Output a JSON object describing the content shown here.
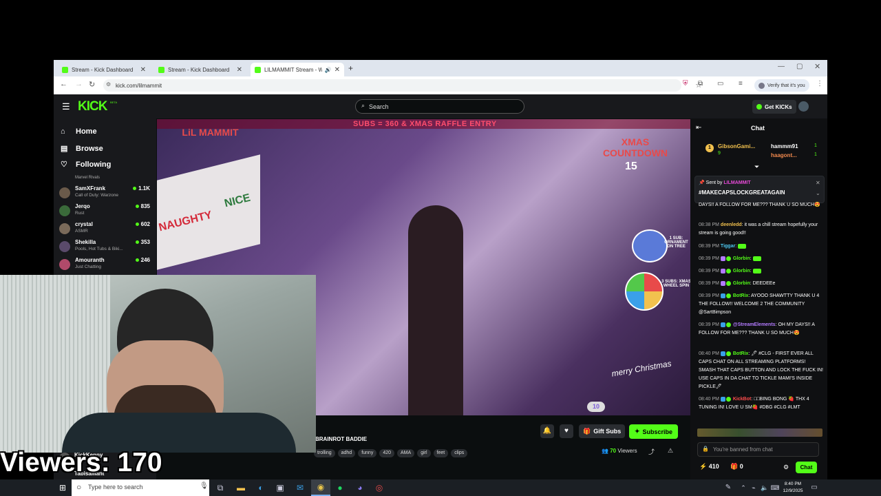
{
  "browser": {
    "tabs": [
      {
        "title": "Stream - Kick Dashboard",
        "active": false
      },
      {
        "title": "Stream - Kick Dashboard",
        "active": false
      },
      {
        "title": "LILMAMMIT Stream - Watch",
        "active": true
      }
    ],
    "url": "kick.com/lilmammit",
    "verify_label": "Verify that it's you"
  },
  "kick": {
    "logo": "KICK",
    "logo_beta": "BETA",
    "search_placeholder": "Search",
    "get_kicks": "Get KICKs",
    "nav": {
      "home": "Home",
      "browse": "Browse",
      "following": "Following"
    },
    "following_partial": "Marvel Rivals",
    "channels": [
      {
        "name": "SamXFrank",
        "game": "Call of Duty: Warzone",
        "viewers": "1.1K"
      },
      {
        "name": "Jerqo",
        "game": "Rust",
        "viewers": "835"
      },
      {
        "name": "crystal",
        "game": "ASMR",
        "viewers": "602"
      },
      {
        "name": "Shekilla",
        "game": "Pools, Hot Tubs & Biki...",
        "viewers": "353"
      },
      {
        "name": "Amouranth",
        "game": "Just Chatting",
        "viewers": "246"
      }
    ],
    "bottom_channels": [
      {
        "name": "KickKenny",
        "game": ""
      },
      {
        "name": "Tabisaillant",
        "game": ""
      }
    ],
    "stream": {
      "overlay_top": "SUBS = 360 & XMAS RAFFLE ENTRY",
      "overlay_lil": "LiL MAMMIT",
      "overlay_countdown": "XMAS COUNTDOWN",
      "overlay_countdown_num": "15",
      "overlay_naughty": "NAUGHTY",
      "overlay_nice": "NICE",
      "overlay_sub1": "1 SUB: ORNAMENT ON TREE",
      "overlay_sub3": "3 SUBS: XMAS WHEEL SPIN",
      "overlay_merry": "merry Christmas",
      "overlay_sub_count": "10",
      "title": "BRAINROT BADDIE",
      "tags": [
        "trolling",
        "adhd",
        "funny",
        "420",
        "AMA",
        "girl",
        "feet",
        "clips"
      ],
      "gift_subs": "Gift Subs",
      "subscribe": "Subscribe",
      "viewers": "70",
      "viewers_label": "Viewers"
    },
    "chat": {
      "title": "Chat",
      "top_gifters": [
        {
          "rank": "1",
          "name": "GibsonGami...",
          "count": "9"
        },
        {
          "rank": "",
          "name": "hammm91",
          "count": "1"
        },
        {
          "rank": "",
          "name": "haagont...",
          "count": "1"
        }
      ],
      "pinned_by_label": "Sent by",
      "pinned_by": "LILMAMMIT",
      "pinned_text": "#MAKECAPSLOCKGREATAGAIN",
      "messages": [
        {
          "time": "",
          "user": "",
          "text": "DAYS!! A FOLLOW FOR ME??? THANK U SO MUCH😍"
        },
        {
          "time": "08:38 PM",
          "user": "deenledd",
          "color": "#f2c14e",
          "text": "it was a chill stream hopefully your stream is going good!!"
        },
        {
          "time": "08:39 PM",
          "user": "Tiggar",
          "color": "#4ec9f2",
          "text": ""
        },
        {
          "time": "08:39 PM",
          "user": "Glorbin",
          "color": "#53fc18",
          "text": ""
        },
        {
          "time": "08:39 PM",
          "user": "Glorbin",
          "color": "#53fc18",
          "text": ""
        },
        {
          "time": "08:39 PM",
          "user": "Glorbin",
          "color": "#53fc18",
          "text": "DEEDEEe"
        },
        {
          "time": "08:39 PM",
          "user": "BotRix",
          "color": "#53fc18",
          "text": "AYOOO SHAWTTY THANK U 4 THE FOLLOW!! WELCOME 2 THE COMMUNITY @SartBimpson"
        },
        {
          "time": "08:39 PM",
          "user": "@StreamElements",
          "color": "#b37bff",
          "text": "OH MY DAYS!! A FOLLOW FOR ME??? THANK U SO MUCH😍"
        },
        {
          "time": "08:40 PM",
          "user": "BotRix",
          "color": "#53fc18",
          "text": "🖊 #CLG - FIRST EVER ALL CAPS CHAT ON ALL STREAMING PLATFORMS! SMASH THAT CAPS BUTTON AND LOCK THE FUCK IN! USE CAPS IN DA CHAT TO TICKLE MAMI'S INSIDE PICKLE🖊"
        },
        {
          "time": "08:40 PM",
          "user": "KickBot",
          "color": "#ff4d4d",
          "text": "□□BING BONG 🍓 THX 4 TUNING IN! LOVE U SM🍓 #DBG #CLG #LMT"
        }
      ],
      "banned_text": "You're banned from chat",
      "points": "410",
      "gifts": "0",
      "chat_button": "Chat"
    }
  },
  "overlay": {
    "viewers_text": "Viewers: 170"
  },
  "taskbar": {
    "search_placeholder": "Type here to search",
    "time": "8:40 PM",
    "date": "12/9/2025"
  },
  "colors": {
    "kick_green": "#53fc18",
    "bg": "#0b0e0f",
    "panel": "#18191c"
  }
}
